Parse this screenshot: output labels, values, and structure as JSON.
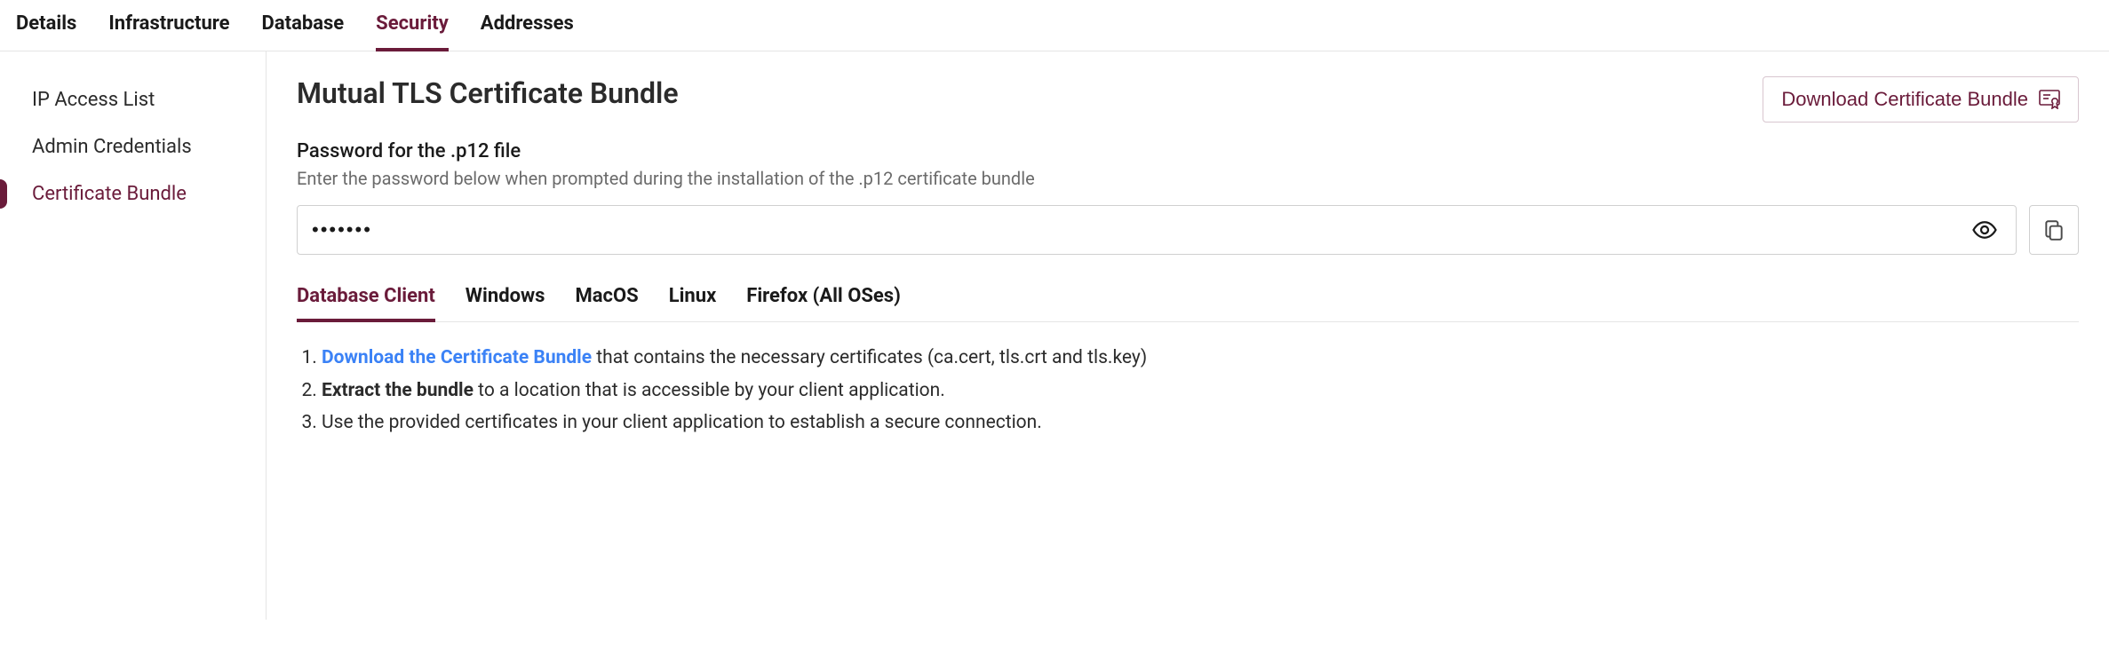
{
  "topTabs": {
    "items": [
      "Details",
      "Infrastructure",
      "Database",
      "Security",
      "Addresses"
    ],
    "activeIndex": 3
  },
  "sidebar": {
    "items": [
      "IP Access List",
      "Admin Credentials",
      "Certificate Bundle"
    ],
    "activeIndex": 2
  },
  "page": {
    "title": "Mutual TLS Certificate Bundle",
    "downloadButton": "Download Certificate Bundle"
  },
  "passwordSection": {
    "label": "Password for the .p12 file",
    "help": "Enter the password below when prompted during the installation of the .p12 certificate bundle",
    "value": "•••••••"
  },
  "subTabs": {
    "items": [
      "Database Client",
      "Windows",
      "MacOS",
      "Linux",
      "Firefox (All OSes)"
    ],
    "activeIndex": 0
  },
  "steps": {
    "step1_link": "Download the Certificate Bundle",
    "step1_rest": " that contains the necessary certificates (ca.cert, tls.crt and tls.key)",
    "step2_bold": "Extract the bundle",
    "step2_rest": " to a location that is accessible by your client application.",
    "step3": "Use the provided certificates in your client application to establish a secure connection."
  }
}
